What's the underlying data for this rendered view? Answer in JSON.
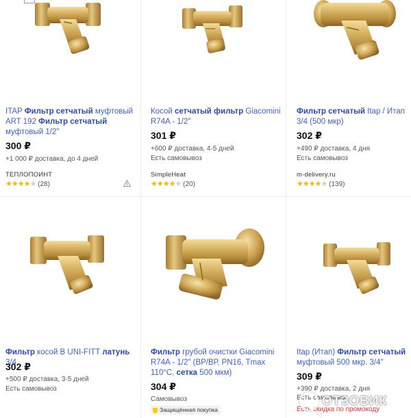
{
  "products": [
    {
      "title_parts": [
        {
          "text": "ITAP ",
          "bold": false
        },
        {
          "text": "Фильтр сетчатый",
          "bold": true
        },
        {
          "text": " муфтовый ART 192 ",
          "bold": false
        },
        {
          "text": "Фильтр сетчатый",
          "bold": true
        },
        {
          "text": " муфтовый 1/2\"",
          "bold": false
        }
      ],
      "price": "300 ₽",
      "delivery": "+1 000 ₽ доставка, до 4 дней",
      "pickup": "",
      "shop": "ТЕПЛОПОИНТ",
      "stars": 4,
      "reviews": "(28)",
      "icon": "warning-icon"
    },
    {
      "title_parts": [
        {
          "text": "Косой ",
          "bold": false
        },
        {
          "text": "сетчатый фильтр",
          "bold": true
        },
        {
          "text": " Giacomini R74A - 1/2\"",
          "bold": false
        }
      ],
      "price": "301 ₽",
      "delivery": "+600 ₽ доставка, 4-5 дней",
      "pickup": "Есть самовывоз",
      "shop": "SimpleHeat",
      "stars": 4,
      "reviews": "(20)"
    },
    {
      "title_parts": [
        {
          "text": "Фильтр сетчатый",
          "bold": true
        },
        {
          "text": " Itap / Итап 3/4 (500 мкр)",
          "bold": false
        }
      ],
      "price": "302 ₽",
      "delivery": "+490 ₽ доставка, 4 дня",
      "pickup": "Есть самовывоз",
      "shop": "m-delivery.ru",
      "stars": 4,
      "reviews": "(139)"
    },
    {
      "title_parts": [
        {
          "text": "Фильтр",
          "bold": true
        },
        {
          "text": " косой B UNI-FITT ",
          "bold": false
        },
        {
          "text": "латунь",
          "bold": true
        },
        {
          "text": " 3/4",
          "bold": false
        }
      ],
      "price": "302 ₽",
      "delivery": "+500 ₽ доставка, 3-5 дней",
      "pickup": "Есть самовывоз"
    },
    {
      "title_parts": [
        {
          "text": "Фильтр",
          "bold": true
        },
        {
          "text": " грубой очистки Giacomini R74A - 1/2\" (ВР/ВР, PN16, Tmax 110°C, ",
          "bold": false
        },
        {
          "text": "сетка",
          "bold": true
        },
        {
          "text": " 500 мкм)",
          "bold": false
        }
      ],
      "price": "304 ₽",
      "pickup": "Самовывоз",
      "badge": "Защищённая покупка"
    },
    {
      "title_parts": [
        {
          "text": "Itap (Итап) ",
          "bold": false
        },
        {
          "text": "Фильтр сетчатый",
          "bold": true
        },
        {
          "text": " муфтовый 500 мкр. 3/4\"",
          "bold": false
        }
      ],
      "price": "309 ₽",
      "delivery": "+390 ₽ доставка, 2 дня",
      "pickup": "Есть самовывоз",
      "promo": "Есть скидка по промокоду"
    }
  ],
  "watermark": "ОТЗОВИК",
  "colors": {
    "link": "#3f61c9",
    "star": "#f5b800",
    "brass": "#c9a04a",
    "promo": "#e0322d"
  }
}
